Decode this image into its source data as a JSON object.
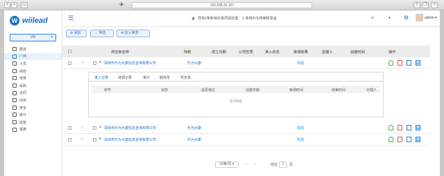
{
  "browser": {
    "url": "192.168.31.107",
    "back": "<",
    "forward": ">"
  },
  "sidebar": {
    "brand_mark": "W",
    "brand_word": "wiilead",
    "vm_label": "VM",
    "items": [
      {
        "label": "概述",
        "icon": "overview-icon"
      },
      {
        "label": "厂商",
        "icon": "vendor-icon"
      },
      {
        "label": "人员",
        "icon": "person-icon"
      },
      {
        "label": "绩效",
        "icon": "chart-icon"
      },
      {
        "label": "培育",
        "icon": "cultivate-icon"
      },
      {
        "label": "采购",
        "icon": "purchase-icon"
      },
      {
        "label": "合同",
        "icon": "contract-icon"
      },
      {
        "label": "商务",
        "icon": "business-icon"
      },
      {
        "label": "安全",
        "icon": "security-icon"
      },
      {
        "label": "审计",
        "icon": "audit-icon"
      },
      {
        "label": "监管",
        "icon": "supervise-icon"
      },
      {
        "label": "报表",
        "icon": "report-icon"
      }
    ]
  },
  "topbar": {
    "notice": "您有2条新待办事项请处理：  1 条待办为待审核事宜",
    "user": "admin"
  },
  "toolbar": {
    "add": "添加",
    "filter": "筛选",
    "join_review": "加入审查"
  },
  "table": {
    "headers": [
      "供应商名称",
      "简称",
      "成立日期",
      "公司性质",
      "准入状态",
      "审调结果",
      "创建人",
      "创建时间",
      "操作"
    ],
    "rows": [
      {
        "name": "深圳市乐为大康信息咨询有限公司",
        "short": "乐为大康",
        "result": "完成"
      },
      {
        "name": "深圳市乐为大康信息咨询有限公司",
        "short": "乐为大康",
        "result": "完成"
      },
      {
        "name": "深圳市乐为大康信息咨询有限公司",
        "short": "乐为大康",
        "result": "完成"
      }
    ]
  },
  "detail": {
    "tabs": [
      "准入记录",
      "待调记录",
      "审计",
      "服务单",
      "安全单"
    ],
    "headers": [
      "序号",
      "状态",
      "是否通过",
      "创建日期",
      "审调时间",
      "结束时间",
      "办理人"
    ],
    "empty": "暂无数据"
  },
  "pager": {
    "per_page": "10条/页",
    "goto_label": "前往",
    "page_value": "1",
    "page_unit": "页"
  }
}
